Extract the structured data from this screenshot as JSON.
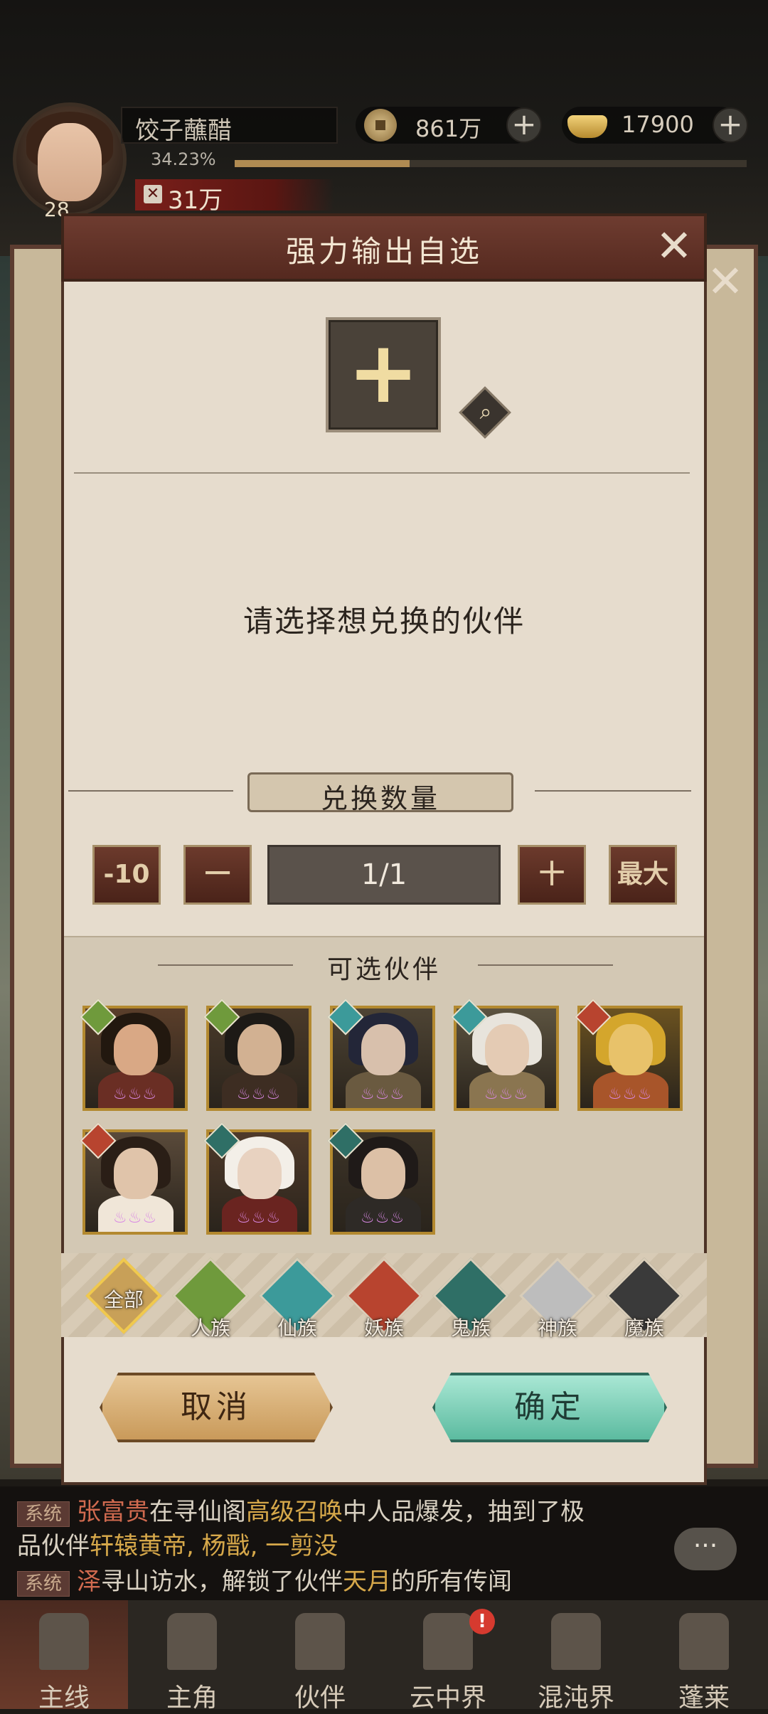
{
  "player": {
    "name": "饺子蘸醋",
    "level": "28",
    "exp_percent": "34.23%",
    "exp_fraction": 0.3423,
    "power": "31万"
  },
  "resources": {
    "copper": "861万",
    "gold": "17900"
  },
  "modal": {
    "title": "强力输出自选",
    "select_prompt": "请选择想兑换的伙伴",
    "quantity_title": "兑换数量",
    "minus10_label": "-10",
    "minus_label": "一",
    "quantity_value": "1/1",
    "plus_label": "十",
    "max_label": "最大",
    "partners_title": "可选伙伴",
    "cancel_label": "取消",
    "confirm_label": "确定"
  },
  "partners": [
    {
      "race": "人族",
      "stars": "♨♨♨"
    },
    {
      "race": "人族",
      "stars": "♨♨♨"
    },
    {
      "race": "仙族",
      "stars": "♨♨♨"
    },
    {
      "race": "仙族",
      "stars": "♨♨♨"
    },
    {
      "race": "妖族",
      "stars": "♨♨♨"
    },
    {
      "race": "妖族",
      "stars": "♨♨♨"
    },
    {
      "race": "鬼族",
      "stars": "♨♨♨"
    },
    {
      "race": "鬼族",
      "stars": "♨♨♨"
    }
  ],
  "filters": [
    {
      "label": "全部"
    },
    {
      "label": "人族"
    },
    {
      "label": "仙族"
    },
    {
      "label": "妖族"
    },
    {
      "label": "鬼族"
    },
    {
      "label": "神族"
    },
    {
      "label": "魔族"
    }
  ],
  "chat": {
    "tag": "系统",
    "line1": {
      "name": "张富贵",
      "t1": "在寻仙阁",
      "hl": "高级召唤",
      "t2": "中人品爆发，抽到了极"
    },
    "line2": {
      "t1": "品伙伴",
      "hl": "轩辕黄帝, 杨戬, 一剪没"
    },
    "line3": {
      "name": "泽",
      "t1": "寻山访水，解锁了伙伴",
      "hl": "天月",
      "t2": "的所有传闻"
    },
    "bubble": "···"
  },
  "nav": [
    {
      "label": "主线"
    },
    {
      "label": "主角"
    },
    {
      "label": "伙伴"
    },
    {
      "label": "云中界",
      "badge": "!"
    },
    {
      "label": "混沌界"
    },
    {
      "label": "蓬莱"
    }
  ],
  "colors": {
    "race_人族": "#6f9a3c",
    "race_仙族": "#3c9a9a",
    "race_妖族": "#b8442f",
    "race_鬼族": "#2f6f66",
    "race_神族": "#bdbdbd",
    "race_魔族": "#3a3a3a",
    "accent_gold": "#b3892f"
  }
}
